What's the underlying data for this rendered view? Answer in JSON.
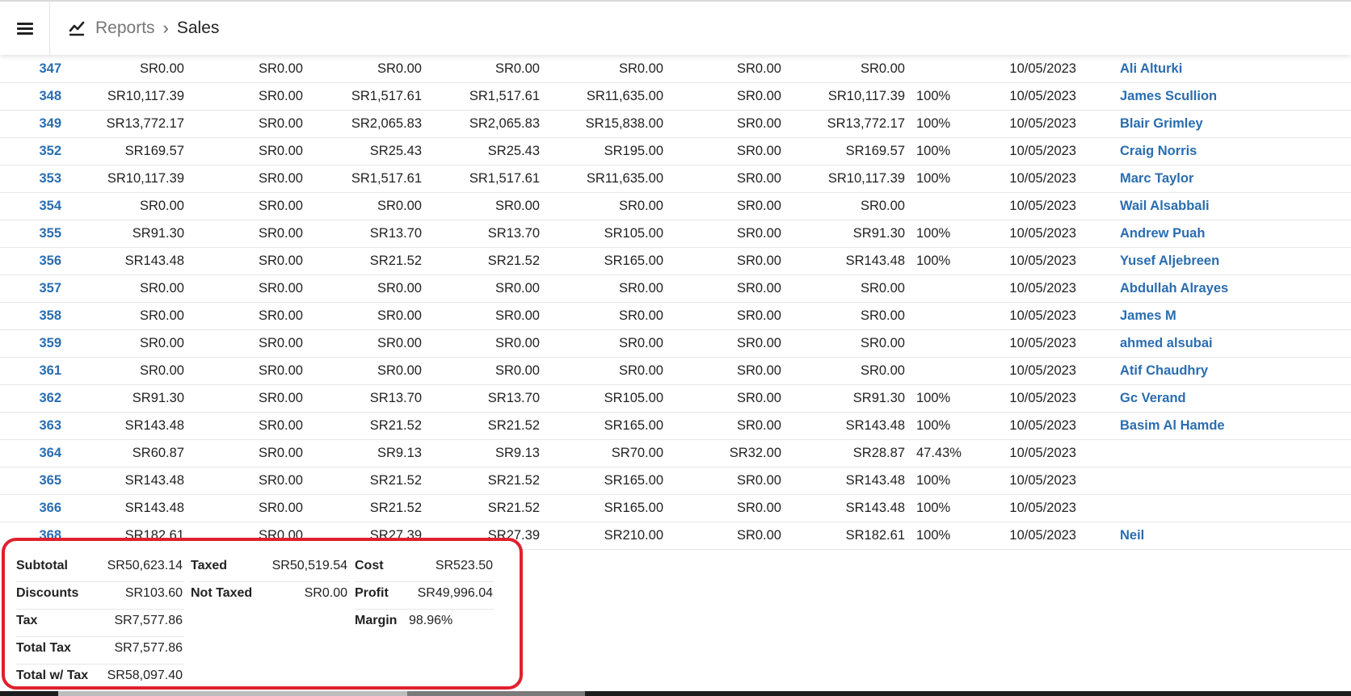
{
  "header": {
    "menu_icon": "hamburger-menu-icon",
    "report_icon": "trending-chart-icon",
    "breadcrumb_parent": "Reports",
    "breadcrumb_current": "Sales"
  },
  "rows": [
    {
      "id": "347",
      "subtotal": "SR0.00",
      "discounts": "SR0.00",
      "tax": "SR0.00",
      "total_tax": "SR0.00",
      "total": "SR0.00",
      "cost": "SR0.00",
      "profit": "SR0.00",
      "margin": "",
      "date": "10/05/2023",
      "customer": "Ali Alturki"
    },
    {
      "id": "348",
      "subtotal": "SR10,117.39",
      "discounts": "SR0.00",
      "tax": "SR1,517.61",
      "total_tax": "SR1,517.61",
      "total": "SR11,635.00",
      "cost": "SR0.00",
      "profit": "SR10,117.39",
      "margin": "100%",
      "date": "10/05/2023",
      "customer": "James Scullion"
    },
    {
      "id": "349",
      "subtotal": "SR13,772.17",
      "discounts": "SR0.00",
      "tax": "SR2,065.83",
      "total_tax": "SR2,065.83",
      "total": "SR15,838.00",
      "cost": "SR0.00",
      "profit": "SR13,772.17",
      "margin": "100%",
      "date": "10/05/2023",
      "customer": "Blair Grimley"
    },
    {
      "id": "352",
      "subtotal": "SR169.57",
      "discounts": "SR0.00",
      "tax": "SR25.43",
      "total_tax": "SR25.43",
      "total": "SR195.00",
      "cost": "SR0.00",
      "profit": "SR169.57",
      "margin": "100%",
      "date": "10/05/2023",
      "customer": "Craig Norris"
    },
    {
      "id": "353",
      "subtotal": "SR10,117.39",
      "discounts": "SR0.00",
      "tax": "SR1,517.61",
      "total_tax": "SR1,517.61",
      "total": "SR11,635.00",
      "cost": "SR0.00",
      "profit": "SR10,117.39",
      "margin": "100%",
      "date": "10/05/2023",
      "customer": "Marc Taylor"
    },
    {
      "id": "354",
      "subtotal": "SR0.00",
      "discounts": "SR0.00",
      "tax": "SR0.00",
      "total_tax": "SR0.00",
      "total": "SR0.00",
      "cost": "SR0.00",
      "profit": "SR0.00",
      "margin": "",
      "date": "10/05/2023",
      "customer": "Wail Alsabbali"
    },
    {
      "id": "355",
      "subtotal": "SR91.30",
      "discounts": "SR0.00",
      "tax": "SR13.70",
      "total_tax": "SR13.70",
      "total": "SR105.00",
      "cost": "SR0.00",
      "profit": "SR91.30",
      "margin": "100%",
      "date": "10/05/2023",
      "customer": "Andrew Puah"
    },
    {
      "id": "356",
      "subtotal": "SR143.48",
      "discounts": "SR0.00",
      "tax": "SR21.52",
      "total_tax": "SR21.52",
      "total": "SR165.00",
      "cost": "SR0.00",
      "profit": "SR143.48",
      "margin": "100%",
      "date": "10/05/2023",
      "customer": "Yusef Aljebreen"
    },
    {
      "id": "357",
      "subtotal": "SR0.00",
      "discounts": "SR0.00",
      "tax": "SR0.00",
      "total_tax": "SR0.00",
      "total": "SR0.00",
      "cost": "SR0.00",
      "profit": "SR0.00",
      "margin": "",
      "date": "10/05/2023",
      "customer": "Abdullah Alrayes"
    },
    {
      "id": "358",
      "subtotal": "SR0.00",
      "discounts": "SR0.00",
      "tax": "SR0.00",
      "total_tax": "SR0.00",
      "total": "SR0.00",
      "cost": "SR0.00",
      "profit": "SR0.00",
      "margin": "",
      "date": "10/05/2023",
      "customer": "James M"
    },
    {
      "id": "359",
      "subtotal": "SR0.00",
      "discounts": "SR0.00",
      "tax": "SR0.00",
      "total_tax": "SR0.00",
      "total": "SR0.00",
      "cost": "SR0.00",
      "profit": "SR0.00",
      "margin": "",
      "date": "10/05/2023",
      "customer": "ahmed alsubai"
    },
    {
      "id": "361",
      "subtotal": "SR0.00",
      "discounts": "SR0.00",
      "tax": "SR0.00",
      "total_tax": "SR0.00",
      "total": "SR0.00",
      "cost": "SR0.00",
      "profit": "SR0.00",
      "margin": "",
      "date": "10/05/2023",
      "customer": "Atif Chaudhry"
    },
    {
      "id": "362",
      "subtotal": "SR91.30",
      "discounts": "SR0.00",
      "tax": "SR13.70",
      "total_tax": "SR13.70",
      "total": "SR105.00",
      "cost": "SR0.00",
      "profit": "SR91.30",
      "margin": "100%",
      "date": "10/05/2023",
      "customer": "Gc Verand"
    },
    {
      "id": "363",
      "subtotal": "SR143.48",
      "discounts": "SR0.00",
      "tax": "SR21.52",
      "total_tax": "SR21.52",
      "total": "SR165.00",
      "cost": "SR0.00",
      "profit": "SR143.48",
      "margin": "100%",
      "date": "10/05/2023",
      "customer": "Basim Al Hamde"
    },
    {
      "id": "364",
      "subtotal": "SR60.87",
      "discounts": "SR0.00",
      "tax": "SR9.13",
      "total_tax": "SR9.13",
      "total": "SR70.00",
      "cost": "SR32.00",
      "profit": "SR28.87",
      "margin": "47.43%",
      "date": "10/05/2023",
      "customer": ""
    },
    {
      "id": "365",
      "subtotal": "SR143.48",
      "discounts": "SR0.00",
      "tax": "SR21.52",
      "total_tax": "SR21.52",
      "total": "SR165.00",
      "cost": "SR0.00",
      "profit": "SR143.48",
      "margin": "100%",
      "date": "10/05/2023",
      "customer": ""
    },
    {
      "id": "366",
      "subtotal": "SR143.48",
      "discounts": "SR0.00",
      "tax": "SR21.52",
      "total_tax": "SR21.52",
      "total": "SR165.00",
      "cost": "SR0.00",
      "profit": "SR143.48",
      "margin": "100%",
      "date": "10/05/2023",
      "customer": ""
    },
    {
      "id": "368",
      "subtotal": "SR182.61",
      "discounts": "SR0.00",
      "tax": "SR27.39",
      "total_tax": "SR27.39",
      "total": "SR210.00",
      "cost": "SR0.00",
      "profit": "SR182.61",
      "margin": "100%",
      "date": "10/05/2023",
      "customer": "Neil"
    }
  ],
  "summary": {
    "subtotal_label": "Subtotal",
    "subtotal": "SR50,623.14",
    "discounts_label": "Discounts",
    "discounts": "SR103.60",
    "tax_label": "Tax",
    "tax": "SR7,577.86",
    "total_tax_label": "Total Tax",
    "total_tax": "SR7,577.86",
    "total_with_tax_label": "Total w/ Tax",
    "total_with_tax": "SR58,097.40",
    "taxed_label": "Taxed",
    "taxed": "SR50,519.54",
    "not_taxed_label": "Not Taxed",
    "not_taxed": "SR0.00",
    "cost_label": "Cost",
    "cost": "SR523.50",
    "profit_label": "Profit",
    "profit": "SR49,996.04",
    "margin_label": "Margin",
    "margin": "98.96%"
  },
  "colors": {
    "link": "#2a6db0",
    "highlight_border": "#e0202e"
  }
}
